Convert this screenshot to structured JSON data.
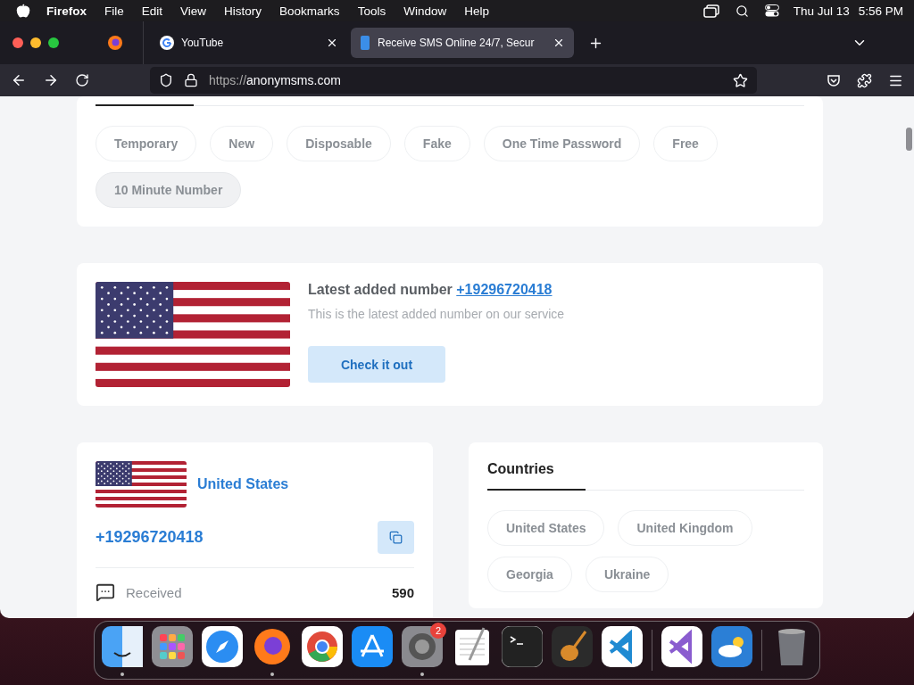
{
  "menu_bar": {
    "app": "Firefox",
    "items": [
      "File",
      "Edit",
      "View",
      "History",
      "Bookmarks",
      "Tools",
      "Window",
      "Help"
    ],
    "date": "Thu Jul 13",
    "time": "5:56 PM"
  },
  "tabs": [
    {
      "title": "YouTube",
      "selected": false
    },
    {
      "title": "Receive SMS Online 24/7, Secur",
      "selected": true
    }
  ],
  "address_bar": {
    "scheme": "https://",
    "host": "anonymsms.com"
  },
  "tags": [
    {
      "label": "Temporary",
      "hovered": false
    },
    {
      "label": "New",
      "hovered": false
    },
    {
      "label": "Disposable",
      "hovered": false
    },
    {
      "label": "Fake",
      "hovered": false
    },
    {
      "label": "One Time Password",
      "hovered": false
    },
    {
      "label": "Free",
      "hovered": false
    },
    {
      "label": "10 Minute Number",
      "hovered": true
    }
  ],
  "latest": {
    "heading": "Latest added number",
    "number": "+19296720418",
    "description": "This is the latest added number on our service",
    "button": "Check it out"
  },
  "number_card": {
    "country": "United States",
    "number": "+19296720418",
    "stats": [
      {
        "label": "Received",
        "value": "590"
      }
    ]
  },
  "countries": {
    "title": "Countries",
    "items": [
      "United States",
      "United Kingdom",
      "Georgia",
      "Ukraine"
    ]
  },
  "dock": {
    "items": [
      {
        "kind": "finder",
        "running": true
      },
      {
        "kind": "launchpad",
        "running": false
      },
      {
        "kind": "safari",
        "running": false
      },
      {
        "kind": "firefox",
        "running": true
      },
      {
        "kind": "chrome",
        "running": false
      },
      {
        "kind": "appstore",
        "running": false
      },
      {
        "kind": "settings",
        "running": true,
        "badge": "2"
      },
      {
        "kind": "textedit",
        "running": false
      },
      {
        "kind": "terminal",
        "running": false
      },
      {
        "kind": "garageband",
        "running": false
      },
      {
        "kind": "vscode",
        "running": false
      },
      {
        "kind": "separator"
      },
      {
        "kind": "visualstudio",
        "running": false
      },
      {
        "kind": "weather",
        "running": false
      },
      {
        "kind": "separator"
      },
      {
        "kind": "trash",
        "running": false
      }
    ]
  }
}
